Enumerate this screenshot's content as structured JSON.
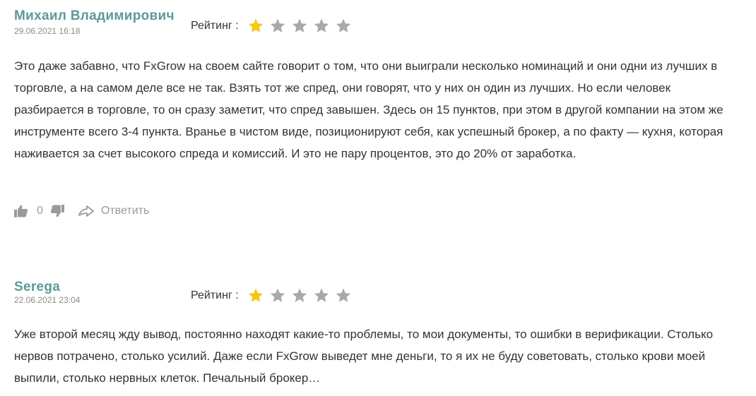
{
  "colors": {
    "author": "#5b9a96",
    "star_filled": "#f5c518",
    "star_empty": "#a9a9a9",
    "meta": "#8a8a8a",
    "action": "#9a9a9a"
  },
  "reviews": [
    {
      "author": "Михаил Владимирович",
      "date": "29.06.2021 16:18",
      "rating_label": "Рейтинг :",
      "rating": 1,
      "rating_max": 5,
      "text": "Это даже забавно, что FxGrow на своем сайте говорит о том, что они выиграли несколько номинаций и они одни из лучших в торговле, а на самом деле все не так. Взять тот же спред, они говорят, что у них он один из лучших. Но если человек разбирается в торговле, то он сразу заметит, что спред завышен. Здесь он 15 пунктов, при этом в другой компании на этом же инструменте всего 3-4 пункта. Вранье в чистом виде, позиционируют себя, как успешный брокер, а по факту — кухня, которая наживается за счет высокого спреда и комиссий. И это не пару процентов, это до 20% от заработка.",
      "likes": "0",
      "reply_label": "Ответить",
      "icons": [
        "thumbs-up-icon",
        "thumbs-down-icon",
        "reply-arrow-icon"
      ]
    },
    {
      "author": "Serega",
      "date": "22.06.2021 23:04",
      "rating_label": "Рейтинг :",
      "rating": 1,
      "rating_max": 5,
      "text": "Уже второй месяц жду вывод, постоянно находят какие-то проблемы, то мои документы, то ошибки в верификации. Столько нервов потрачено, столько усилий. Даже если FxGrow выведет мне деньги, то я их не буду советовать, столько крови моей выпили, столько нервных клеток. Печальный брокер…"
    }
  ]
}
